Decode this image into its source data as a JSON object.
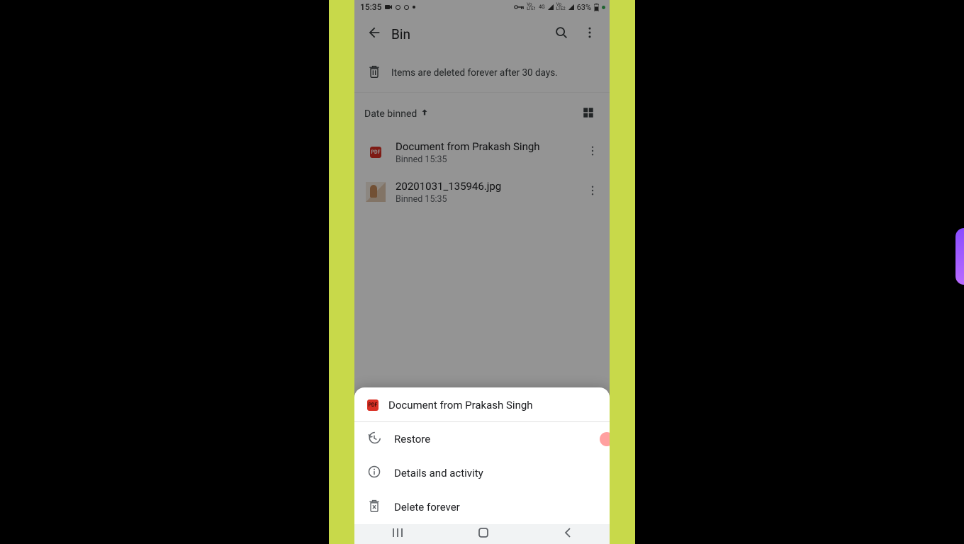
{
  "status": {
    "time": "15:35",
    "battery": "63%",
    "net1": "VoLTE1 4G",
    "net2": "VoLTE2"
  },
  "header": {
    "title": "Bin"
  },
  "banner": {
    "text": "Items are deleted forever after 30 days."
  },
  "sort": {
    "label": "Date binned"
  },
  "files": [
    {
      "name": "Document from Prakash Singh",
      "meta": "Binned 15:35",
      "type": "pdf"
    },
    {
      "name": "20201031_135946.jpg",
      "meta": "Binned 15:35",
      "type": "image"
    }
  ],
  "sheet": {
    "title": "Document from Prakash Singh",
    "icon": "pdf",
    "items": [
      {
        "icon": "restore-icon",
        "label": "Restore"
      },
      {
        "icon": "info-icon",
        "label": "Details and activity"
      },
      {
        "icon": "delete-forever-icon",
        "label": "Delete forever"
      }
    ]
  }
}
